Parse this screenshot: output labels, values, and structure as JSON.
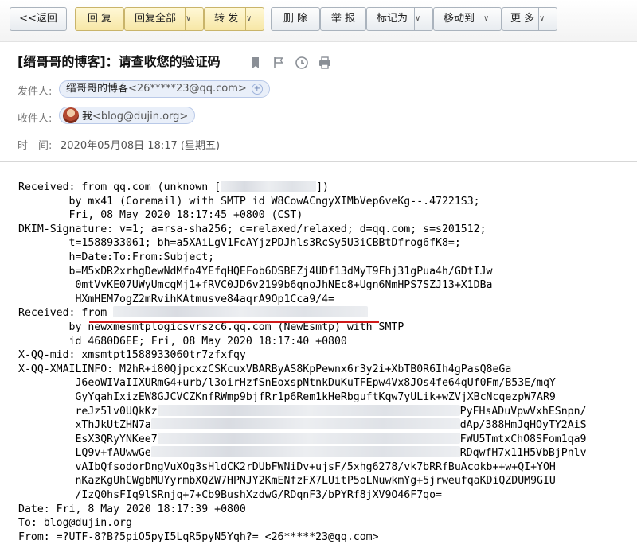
{
  "toolbar": {
    "back": "<<返回",
    "reply": "回 复",
    "reply_all": "回复全部",
    "forward": "转 发",
    "delete": "删 除",
    "report": "举 报",
    "mark_as": "标记为",
    "move_to": "移动到",
    "more": "更 多",
    "caret": "∨"
  },
  "header": {
    "subject": "[缙哥哥的博客]：请查收您的验证码",
    "icons": [
      "bookmark-icon",
      "flag-icon",
      "clock-icon",
      "print-icon"
    ],
    "from_label": "发件人:",
    "from_name": "缙哥哥的博客",
    "from_addr": "<26*****23@qq.com>",
    "to_label": "收件人:",
    "to_name": "我",
    "to_addr": "<blog@dujin.org>",
    "time_label": "时　间:",
    "time_value": "2020年05月08日 18:17 (星期五)"
  },
  "source": {
    "l1_a": "Received: from qq.com (unknown [",
    "l1_b": "])",
    "l2": "        by mx41 (Coremail) with SMTP id W8CowACngyXIMbVep6veKg--.47221S3;",
    "l3": "        Fri, 08 May 2020 18:17:45 +0800 (CST)",
    "l4": "DKIM-Signature: v=1; a=rsa-sha256; c=relaxed/relaxed; d=qq.com; s=s201512;",
    "l5": "        t=1588933061; bh=a5XAiLgV1FcAYjzPDJhls3RcSy5U3iCBBtDfrog6fK8=;",
    "l6": "        h=Date:To:From:Subject;",
    "l7": "        b=M5xDR2xrhgDewNdMfo4YEfqHQEFob6DSBEZj4UDf13dMyT9Fhj31gPua4h/GDtIJw",
    "l8": "         0mtVvKE07UWyUmcgMj1+fRVC0JD6v2199b6qnoJhNEc8+Ugn6NmHPS7SZJ13+X1DBa",
    "l9": "         HXmHEM7ogZ2mRvihKAtmusve84aqrA9Op1Cca9/4=",
    "l10_a": "Received: from ",
    "l11": "        by newxmesmtplogicsvrszc6.qq.com (NewEsmtp) with SMTP",
    "l12": "        id 4680D6EE; Fri, 08 May 2020 18:17:40 +0800",
    "l13": "X-QQ-mid: xmsmtpt1588933060tr7zfxfqy",
    "l14": "X-QQ-XMAILINFO: M2hR+i80QjpcxzCSKcuxVBARByAS8KpPewnx6r3y2i+XbTB0R6Ih4gPasQ8eGa",
    "l15": "         J6eoWIVaIIXURmG4+urb/l3oirHzfSnEoxspNtnkDuKuTFEpw4Vx8JOs4fe64qUf0Fm/B53E/mqY",
    "l16": "         GyYqahIxizEW8GJCVCZKnfRWmp9bjfRr1p6Rem1kHeRbguftKqw7yULik+wZVjXBcNcqezpW7AR9",
    "l17_a": "         reJz5lv0UQkKz",
    "l17_b": "PyFHsADuVpwVxhESnpn/",
    "l18_a": "         xThJkUtZHN7a",
    "l18_b": "dAp/388HmJqHOyTY2AiS",
    "l19_a": "         EsX3QRyYNKee7",
    "l19_b": "FWU5TmtxChO8SFom1qa9",
    "l20_a": "         LQ9v+fAUwwGe",
    "l20_b": "RDqwfH7x11H5VbBjPnlv",
    "l21": "         vAIbQfsodorDngVuXOg3sHldCK2rDUbFWNiDv+ujsF/5xhg6278/vk7bRRfBuAcokb++w+QI+YOH",
    "l22": "         nKazKgUhCWgbMUYyrmbXQZW7HPNJY2KmENfzFX7LUitP5oLNuwkmYg+5jrweufqaKDiQZDUM9GIU",
    "l23": "         /IzQ0hsFIq9lSRnjq+7+Cb9BushXzdwG/RDqnF3/bPYRf8jXV9O46F7qo=",
    "l24": "Date: Fri, 8 May 2020 18:17:39 +0800",
    "l25": "To: blog@dujin.org",
    "l26": "From: =?UTF-8?B?5piO5pyI5LqR5pyN5Yqh?= <26*****23@qq.com>"
  }
}
